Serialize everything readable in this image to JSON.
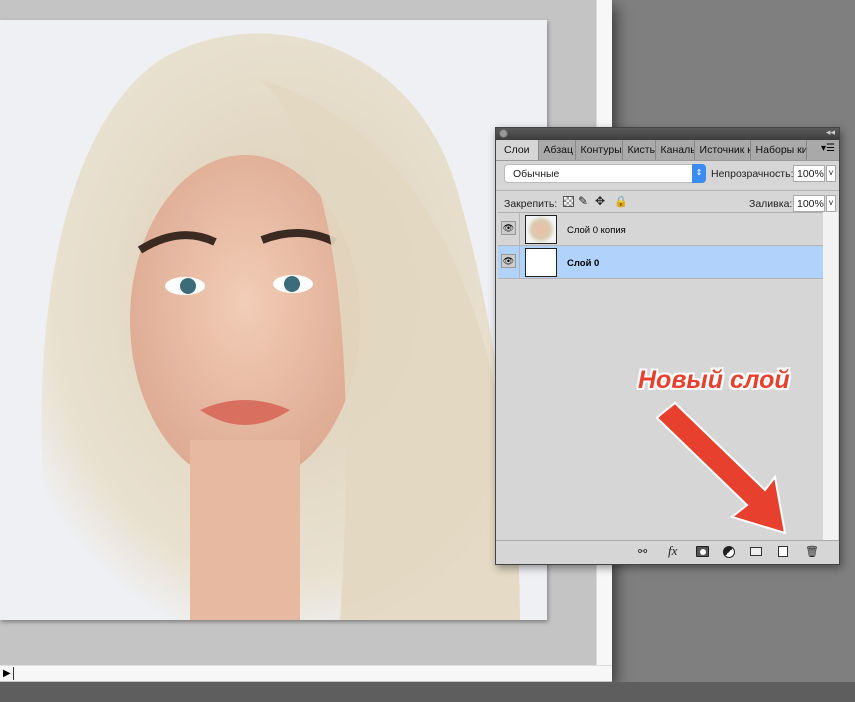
{
  "panel": {
    "tabs": [
      "Слои",
      "Абзац",
      "Контуры",
      "Кисть",
      "Каналы",
      "Источник к",
      "Наборы ки"
    ],
    "active_tab": "Слои",
    "blend_mode": "Обычные",
    "opacity_label": "Непрозрачность:",
    "opacity_value": "100%",
    "lock_label": "Закрепить:",
    "fill_label": "Заливка:",
    "fill_value": "100%",
    "layers": [
      {
        "name": "Слой 0 копия",
        "visible": true,
        "selected": false
      },
      {
        "name": "Слой 0",
        "visible": true,
        "selected": true
      }
    ],
    "toolbar_icons": [
      "link-icon",
      "fx-icon",
      "mask-icon",
      "adjustment-icon",
      "folder-icon",
      "new-layer-icon",
      "trash-icon"
    ]
  },
  "annotation": {
    "text": "Новый слой",
    "color": "#e8402e"
  }
}
